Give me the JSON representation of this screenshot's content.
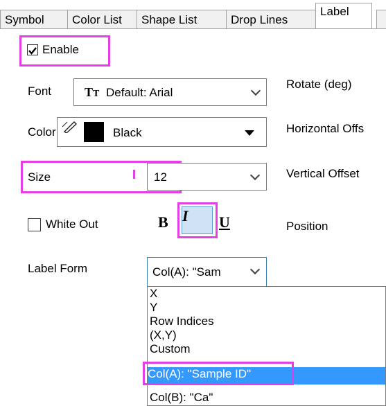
{
  "tabs": [
    {
      "label": "Symbol"
    },
    {
      "label": "Color List"
    },
    {
      "label": "Shape List"
    },
    {
      "label": "Drop Lines"
    },
    {
      "label": "Label"
    }
  ],
  "enable": {
    "label": "Enable",
    "checked": true
  },
  "font": {
    "label": "Font",
    "value": "Default: Arial",
    "icon": "truetype-font-icon"
  },
  "color": {
    "label": "Color",
    "value": "Black",
    "swatch": "#000000"
  },
  "size": {
    "label": "Size",
    "value": "12"
  },
  "white_out": {
    "label": "White Out",
    "checked": false
  },
  "style_buttons": {
    "bold": "B",
    "italic": "I",
    "underline": "U"
  },
  "right_labels": {
    "rotate": "Rotate (deg)",
    "horizontal": "Horizontal Offs",
    "vertical": "Vertical Offset",
    "position": "Position"
  },
  "label_form": {
    "label": "Label Form",
    "selected": "Col(A): \"Sam",
    "options": [
      "X",
      "Y",
      "Row Indices",
      "(X,Y)",
      "Custom",
      "Col(A): \"Sample ID\"",
      "Col(B): \"Ca\""
    ],
    "highlighted_option": "Col(A): \"Sample ID\""
  },
  "colors": {
    "highlight": "#e43fe4",
    "selection": "#3399ff"
  }
}
